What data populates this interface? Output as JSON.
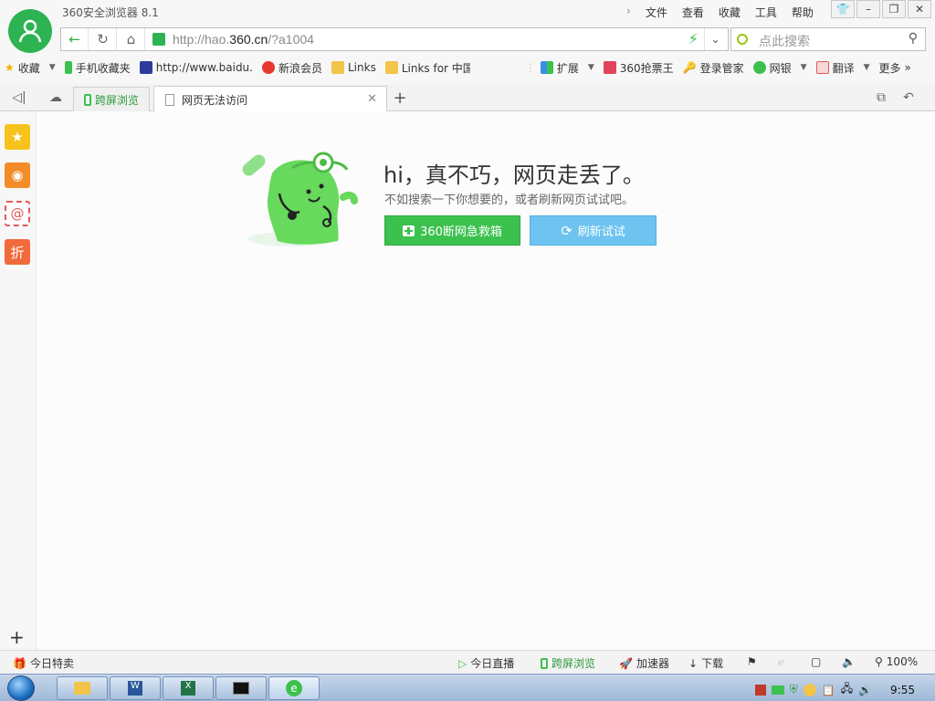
{
  "app": {
    "title": "360安全浏览器 8.1"
  },
  "menu": [
    "文件",
    "查看",
    "收藏",
    "工具",
    "帮助"
  ],
  "address": {
    "url_prefix": "http://hao.",
    "url_domain": "360.cn",
    "url_suffix": "/?a1004"
  },
  "search": {
    "placeholder": "点此搜索"
  },
  "favorites": {
    "left": [
      "收藏",
      "手机收藏夹",
      "http://www.baidu.",
      "新浪会员",
      "Links",
      "Links for 中国"
    ],
    "right": [
      "扩展",
      "360抢票王",
      "登录管家",
      "网银",
      "翻译",
      "更多"
    ]
  },
  "tabs": {
    "sync": "跨屏浏览",
    "active": "网页无法访问"
  },
  "error": {
    "title": "hi，真不巧，网页走丢了。",
    "subtitle": "不如搜索一下你想要的，或者刷新网页试试吧。",
    "rescue_button": "360断网急救箱",
    "refresh_button": "刷新试试"
  },
  "statusbar": {
    "deals": "今日特卖",
    "live": "今日直播",
    "sync": "跨屏浏览",
    "accelerator": "加速器",
    "download": "下载",
    "zoom": "100%"
  },
  "taskbar": {
    "time": "9:55"
  },
  "colors": {
    "green": "#2db352",
    "blue": "#6ec3f0",
    "rescue_green": "#3cc14e"
  }
}
